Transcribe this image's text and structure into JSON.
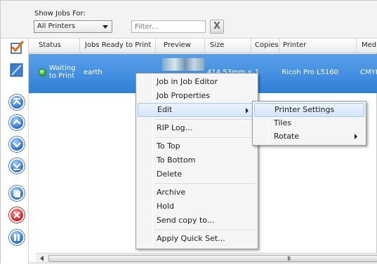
{
  "filter_bar": {
    "show_jobs_label": "Show Jobs For:",
    "printer_select_value": "All Printers",
    "filter_placeholder": "Filter...",
    "clear_button": "X"
  },
  "columns": [
    "Status",
    "Jobs Ready to Print",
    "Preview",
    "Size",
    "Copies",
    "Printer",
    "Media"
  ],
  "job_row": {
    "status": "Waiting to Print",
    "job_name": "earth",
    "size": "414.53mm x",
    "copies": "1",
    "printer": "Ricoh Pro L5160",
    "media": "CMYK"
  },
  "context_menu": {
    "items": [
      {
        "label": "Job in Job Editor"
      },
      {
        "label": "Job Properties"
      },
      {
        "label": "Edit",
        "submenu": true
      },
      {
        "label": "RIP Log..."
      },
      {
        "label": "To Top"
      },
      {
        "label": "To Bottom"
      },
      {
        "label": "Delete"
      },
      {
        "label": "Archive"
      },
      {
        "label": "Hold"
      },
      {
        "label": "Send copy to..."
      },
      {
        "label": "Apply Quick Set..."
      }
    ]
  },
  "edit_submenu": {
    "items": [
      {
        "label": "Printer Settings"
      },
      {
        "label": "Tiles"
      },
      {
        "label": "Rotate",
        "submenu": true
      }
    ]
  },
  "scrollbar": {
    "grip": "III"
  },
  "icons": [
    "checklist-icon",
    "edit-icon",
    "move-top-icon",
    "move-up-icon",
    "move-down-icon",
    "move-bottom-icon",
    "copy-icon",
    "delete-icon",
    "pause-icon"
  ],
  "colors": {
    "selection": "#3a89dd",
    "menu_highlight": "#dbe9fb",
    "status_ok": "#2da21f",
    "delete": "#cf2222"
  }
}
